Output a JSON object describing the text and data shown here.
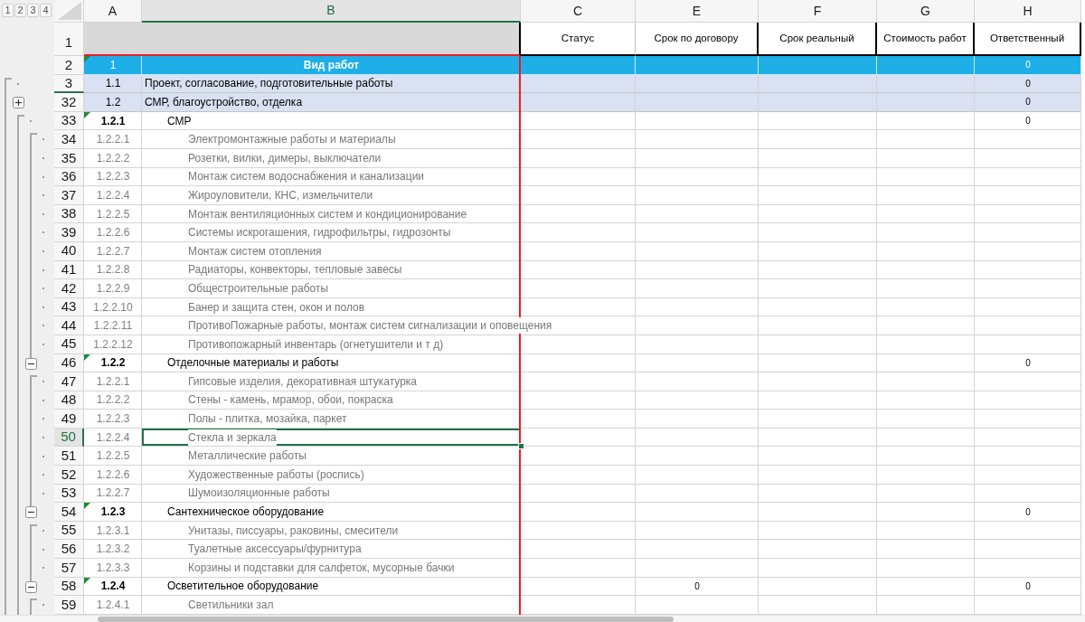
{
  "outline_levels": [
    "1",
    "2",
    "3",
    "4"
  ],
  "columns": [
    {
      "letter": "A",
      "selected": false
    },
    {
      "letter": "B",
      "selected": true
    },
    {
      "letter": "C",
      "selected": false
    },
    {
      "letter": "E",
      "selected": false
    },
    {
      "letter": "F",
      "selected": false
    },
    {
      "letter": "G",
      "selected": false
    },
    {
      "letter": "H",
      "selected": false
    }
  ],
  "header_row": {
    "row": "1",
    "labels": [
      "Статус",
      "Срок по договору",
      "Срок реальный",
      "Стоимость работ",
      "Ответственный"
    ]
  },
  "rows": [
    {
      "kind": "title",
      "row": "2",
      "number": "1",
      "work": "Вид работ",
      "responsible": "0",
      "flagged": true,
      "selected": false
    },
    {
      "kind": "group",
      "expanded": true,
      "children": [
        {
          "kind": "section",
          "row": "3",
          "number": "1.1",
          "work": "Проект, согласование, подготовительные работы",
          "responsible": "0",
          "flagged": false,
          "selected": false
        },
        {
          "kind": "group",
          "expanded": false
        },
        {
          "kind": "section",
          "row": "32",
          "number": "1.2",
          "work": "СМР, благоустройство, отделка",
          "responsible": "0",
          "flagged": false,
          "selected": false
        },
        {
          "kind": "group",
          "expanded": true,
          "children": [
            {
              "kind": "subsection",
              "row": "33",
              "number": "1.2.1",
              "work": "СМР",
              "responsible": "0",
              "flagged": true,
              "selected": false
            },
            {
              "kind": "group",
              "expanded": true,
              "children": [
                {
                  "kind": "item",
                  "row": "34",
                  "number": "1.2.2.1",
                  "work": "Электромонтажные работы и материалы",
                  "flagged": false,
                  "selected": false
                },
                {
                  "kind": "item",
                  "row": "35",
                  "number": "1.2.2.2",
                  "work": "Розетки, вилки, димеры, выключатели",
                  "flagged": false,
                  "selected": false
                },
                {
                  "kind": "item",
                  "row": "36",
                  "number": "1.2.2.3",
                  "work": "Монтаж систем водоснабжения и канализации",
                  "flagged": false,
                  "selected": false
                },
                {
                  "kind": "item",
                  "row": "37",
                  "number": "1.2.2.4",
                  "work": "Жироуловители, КНС, измельчители",
                  "flagged": false,
                  "selected": false
                },
                {
                  "kind": "item",
                  "row": "38",
                  "number": "1.2.2.5",
                  "work": "Монтаж вентиляционных систем и кондиционирование",
                  "flagged": false,
                  "selected": false
                },
                {
                  "kind": "item",
                  "row": "39",
                  "number": "1.2.2.6",
                  "work": "Системы искрогашения, гидрофильтры, гидрозонты",
                  "flagged": false,
                  "selected": false
                },
                {
                  "kind": "item",
                  "row": "40",
                  "number": "1.2.2.7",
                  "work": "Монтаж систем отопления",
                  "flagged": false,
                  "selected": false
                },
                {
                  "kind": "item",
                  "row": "41",
                  "number": "1.2.2.8",
                  "work": "Радиаторы, конвекторы, тепловые завесы",
                  "flagged": false,
                  "selected": false
                },
                {
                  "kind": "item",
                  "row": "42",
                  "number": "1.2.2.9",
                  "work": "Общестроительные работы",
                  "flagged": false,
                  "selected": false
                },
                {
                  "kind": "item",
                  "row": "43",
                  "number": "1.2.2.10",
                  "work": "Банер и защита стен, окон и полов",
                  "flagged": false,
                  "selected": false
                },
                {
                  "kind": "item",
                  "row": "44",
                  "number": "1.2.2.11",
                  "work": "ПротивоПожарные работы, монтаж систем сигнализации и оповещения",
                  "flagged": false,
                  "selected": false
                },
                {
                  "kind": "item",
                  "row": "45",
                  "number": "1.2.2.12",
                  "work": "Противопожарный инвентарь (огнетушители и т д)",
                  "flagged": false,
                  "selected": false
                }
              ]
            },
            {
              "kind": "subsection",
              "row": "46",
              "number": "1.2.2",
              "work": "Отделочные материалы и работы",
              "responsible": "0",
              "flagged": true,
              "selected": false
            },
            {
              "kind": "group",
              "expanded": true,
              "children": [
                {
                  "kind": "item",
                  "row": "47",
                  "number": "1.2.2.1",
                  "work": "Гипсовые изделия, декоративная штукатурка",
                  "flagged": false,
                  "selected": false
                },
                {
                  "kind": "item",
                  "row": "48",
                  "number": "1.2.2.2",
                  "work": "Стены - камень, мрамор, обои, покраска",
                  "flagged": false,
                  "selected": false
                },
                {
                  "kind": "item",
                  "row": "49",
                  "number": "1.2.2.3",
                  "work": "Полы - плитка, мозайка, паркет",
                  "flagged": false,
                  "selected": false
                },
                {
                  "kind": "item",
                  "row": "50",
                  "number": "1.2.2.4",
                  "work": "Стекла и зеркала",
                  "flagged": false,
                  "selected": true
                },
                {
                  "kind": "item",
                  "row": "51",
                  "number": "1.2.2.5",
                  "work": "Металлические работы",
                  "flagged": false,
                  "selected": false
                },
                {
                  "kind": "item",
                  "row": "52",
                  "number": "1.2.2.6",
                  "work": "Художественные работы (роспись)",
                  "flagged": false,
                  "selected": false
                },
                {
                  "kind": "item",
                  "row": "53",
                  "number": "1.2.2.7",
                  "work": "Шумоизоляционные работы",
                  "flagged": false,
                  "selected": false
                }
              ]
            },
            {
              "kind": "subsection",
              "row": "54",
              "number": "1.2.3",
              "work": "Сантехническое оборудование",
              "responsible": "0",
              "flagged": true,
              "selected": false
            },
            {
              "kind": "group",
              "expanded": true,
              "children": [
                {
                  "kind": "item",
                  "row": "55",
                  "number": "1.2.3.1",
                  "work": "Унитазы, писсуары, раковины, смесители",
                  "flagged": false,
                  "selected": false
                },
                {
                  "kind": "item",
                  "row": "56",
                  "number": "1.2.3.2",
                  "work": "Туалетные аксессуары/фурнитура",
                  "flagged": false,
                  "selected": false
                },
                {
                  "kind": "item",
                  "row": "57",
                  "number": "1.2.3.3",
                  "work": "Корзины и подставки для салфеток, мусорные бачки",
                  "flagged": false,
                  "selected": false
                }
              ]
            },
            {
              "kind": "subsection",
              "row": "58",
              "number": "1.2.4",
              "work": "Осветительное оборудование",
              "contract_term": "0",
              "responsible": "0",
              "flagged": true,
              "selected": false
            },
            {
              "kind": "group",
              "expanded": true,
              "children": [
                {
                  "kind": "item",
                  "row": "59",
                  "number": "1.2.4.1",
                  "work": "Светильники зал",
                  "flagged": false,
                  "selected": false
                }
              ]
            }
          ]
        }
      ]
    }
  ]
}
